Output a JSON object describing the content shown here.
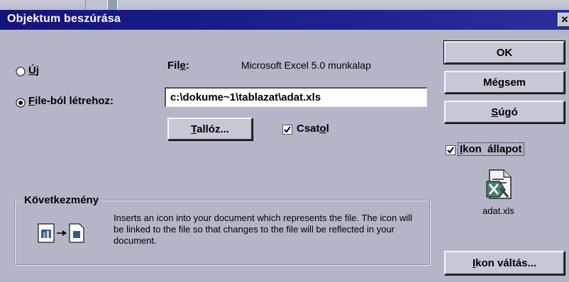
{
  "dialog": {
    "title": "Objektum beszúrása",
    "close_symbol": "✕",
    "radio_new": {
      "accel": "Ú",
      "rest": "j"
    },
    "radio_file": {
      "accel": "F",
      "rest": "ile-ból létrehoz:"
    },
    "file_label": {
      "pre": "Fil",
      "accel": "e",
      "post": ":"
    },
    "file_type": "Microsoft Excel 5.0 munkalap",
    "file_path": "c:\\dokume~1\\tablazat\\adat.xls",
    "browse_button": {
      "accel": "T",
      "rest": "allóz..."
    },
    "link_checkbox": {
      "pre": "Csat",
      "accel": "o",
      "post": "l",
      "checked": true
    },
    "ok_button": "OK",
    "cancel_button": "Mégsem",
    "help_button": {
      "accel": "S",
      "rest": "úgó"
    },
    "icon_checkbox": {
      "accel": "I",
      "rest": "kon  állapot",
      "checked": true
    },
    "icon_caption": "adat.xls",
    "change_icon_button": {
      "accel": "I",
      "rest": "kon váltás..."
    },
    "result_group_title": "Következmény",
    "result_text": "Inserts an icon into your document which represents the file.  The icon will be linked to the file so that changes to the file will be reflected in your document.",
    "icons": {
      "result_preview": "linked-document-icon",
      "excel_file": "excel-file-icon"
    },
    "colors": {
      "title_bar": "#14147a",
      "dialog_background": "#b4b6c8"
    }
  }
}
